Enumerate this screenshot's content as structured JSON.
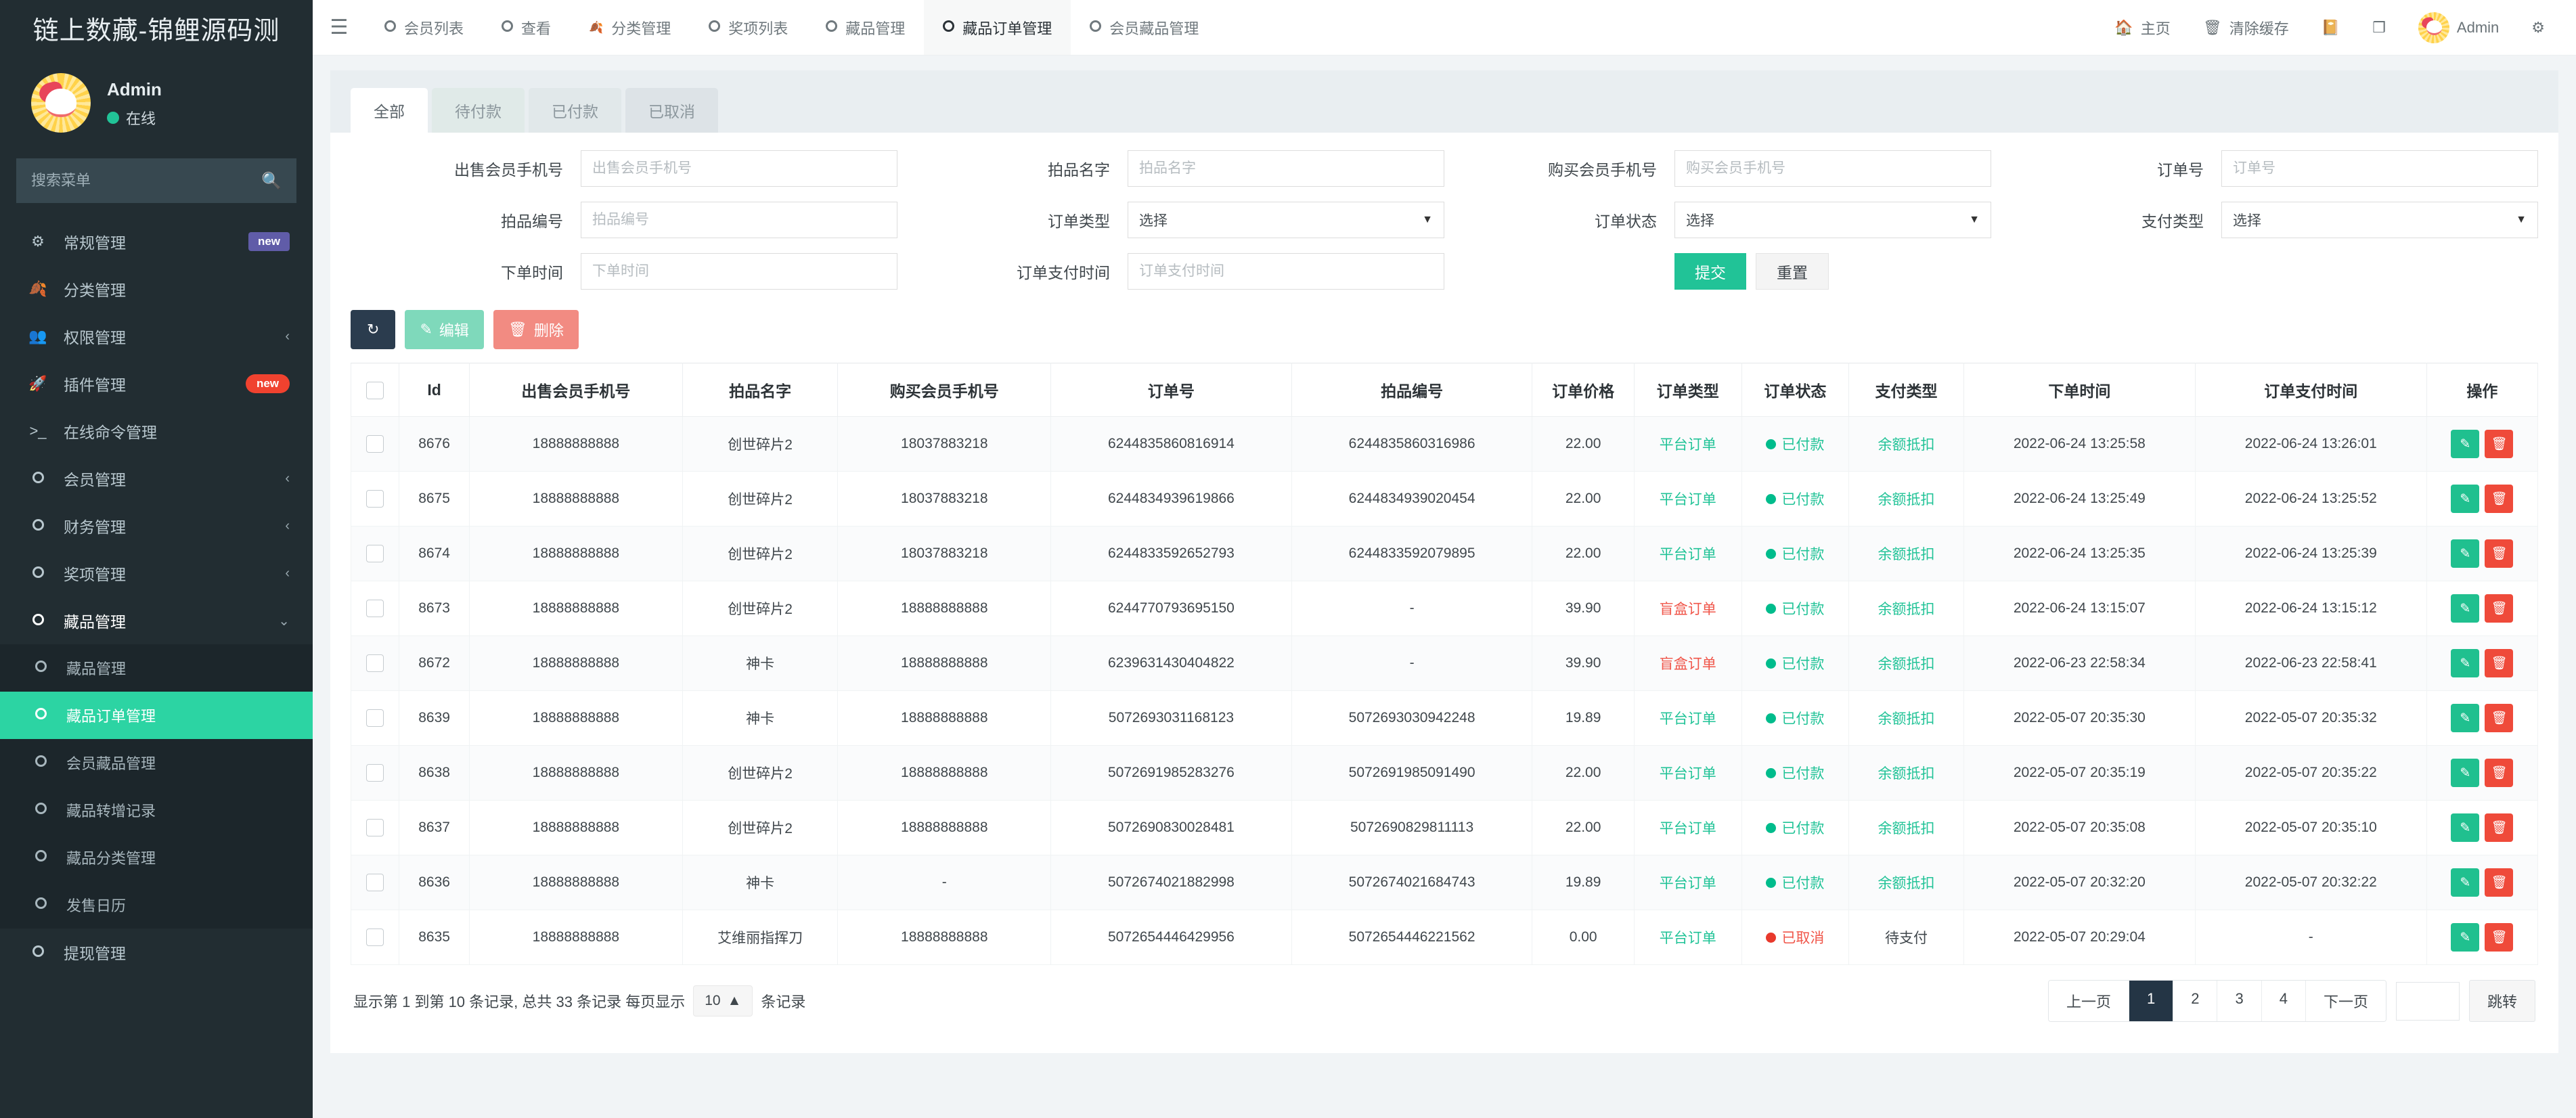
{
  "sidebar": {
    "brand": "链上数藏-锦鲤源码测",
    "user": {
      "name": "Admin",
      "status": "在线"
    },
    "search_placeholder": "搜索菜单",
    "items": [
      {
        "label": "常规管理",
        "icon": "gears-icon",
        "badge": "new",
        "badge_color": "purple",
        "chev": ""
      },
      {
        "label": "分类管理",
        "icon": "leaf-icon",
        "badge": "",
        "badge_color": "",
        "chev": ""
      },
      {
        "label": "权限管理",
        "icon": "users-icon",
        "badge": "",
        "badge_color": "",
        "chev": "‹"
      },
      {
        "label": "插件管理",
        "icon": "rocket-icon",
        "badge": "new",
        "badge_color": "red",
        "chev": ""
      },
      {
        "label": "在线命令管理",
        "icon": "terminal-icon",
        "badge": "",
        "badge_color": "",
        "chev": ""
      },
      {
        "label": "会员管理",
        "icon": "circle-icon",
        "badge": "",
        "badge_color": "",
        "chev": "‹"
      },
      {
        "label": "财务管理",
        "icon": "circle-icon",
        "badge": "",
        "badge_color": "",
        "chev": "‹"
      },
      {
        "label": "奖项管理",
        "icon": "circle-icon",
        "badge": "",
        "badge_color": "",
        "chev": "‹"
      },
      {
        "label": "藏品管理",
        "icon": "circle-icon",
        "badge": "",
        "badge_color": "",
        "chev": "⌄",
        "active": true
      }
    ],
    "subitems": [
      {
        "label": "藏品管理",
        "active": false
      },
      {
        "label": "藏品订单管理",
        "active": true
      },
      {
        "label": "会员藏品管理",
        "active": false
      },
      {
        "label": "藏品转增记录",
        "active": false
      },
      {
        "label": "藏品分类管理",
        "active": false
      },
      {
        "label": "发售日历",
        "active": false
      },
      {
        "label": "提现管理",
        "active": false
      }
    ]
  },
  "topbar": {
    "menu_icon": "hamburger-icon",
    "tabs": [
      {
        "label": "会员列表",
        "icon": "circle-icon",
        "active": false
      },
      {
        "label": "查看",
        "icon": "circle-icon",
        "active": false
      },
      {
        "label": "分类管理",
        "icon": "leaf-icon",
        "active": false
      },
      {
        "label": "奖项列表",
        "icon": "circle-icon",
        "active": false
      },
      {
        "label": "藏品管理",
        "icon": "circle-icon",
        "active": false
      },
      {
        "label": "藏品订单管理",
        "icon": "circle-icon",
        "active": true
      },
      {
        "label": "会员藏品管理",
        "icon": "circle-icon",
        "active": false
      }
    ],
    "right": [
      {
        "label": "主页",
        "icon": "home-icon"
      },
      {
        "label": "清除缓存",
        "icon": "trash-icon"
      },
      {
        "label": "",
        "icon": "book-icon"
      },
      {
        "label": "",
        "icon": "fullscreen-icon"
      },
      {
        "label": "Admin",
        "icon": "avatar-icon"
      },
      {
        "label": "",
        "icon": "gear-icon"
      }
    ]
  },
  "tabs": [
    {
      "label": "全部",
      "active": true
    },
    {
      "label": "待付款",
      "active": false
    },
    {
      "label": "已付款",
      "active": false
    },
    {
      "label": "已取消",
      "active": false
    }
  ],
  "filters": {
    "row1": [
      {
        "label": "出售会员手机号",
        "placeholder": "出售会员手机号",
        "value": "",
        "type": "text"
      },
      {
        "label": "拍品名字",
        "placeholder": "拍品名字",
        "value": "",
        "type": "text"
      },
      {
        "label": "购买会员手机号",
        "placeholder": "购买会员手机号",
        "value": "",
        "type": "text"
      },
      {
        "label": "订单号",
        "placeholder": "订单号",
        "value": "",
        "type": "text"
      }
    ],
    "row2": [
      {
        "label": "拍品编号",
        "placeholder": "拍品编号",
        "value": "",
        "type": "text"
      },
      {
        "label": "订单类型",
        "placeholder": "",
        "value": "选择",
        "type": "select"
      },
      {
        "label": "订单状态",
        "placeholder": "",
        "value": "选择",
        "type": "select"
      },
      {
        "label": "支付类型",
        "placeholder": "",
        "value": "选择",
        "type": "select"
      }
    ],
    "row3": [
      {
        "label": "下单时间",
        "placeholder": "下单时间",
        "value": "",
        "type": "text"
      },
      {
        "label": "订单支付时间",
        "placeholder": "订单支付时间",
        "value": "",
        "type": "text"
      }
    ],
    "submit_label": "提交",
    "reset_label": "重置"
  },
  "toolbar": {
    "refresh_icon": "refresh-icon",
    "edit_label": "编辑",
    "edit_icon": "pencil-icon",
    "delete_label": "删除",
    "delete_icon": "trash-icon"
  },
  "table": {
    "columns": [
      "",
      "Id",
      "出售会员手机号",
      "拍品名字",
      "购买会员手机号",
      "订单号",
      "拍品编号",
      "订单价格",
      "订单类型",
      "订单状态",
      "支付类型",
      "下单时间",
      "订单支付时间",
      "操作"
    ],
    "rows": [
      {
        "id": "8676",
        "seller": "18888888888",
        "item": "创世碎片2",
        "buyer": "18037883218",
        "order_no": "6244835860816914",
        "item_no": "6244835860316986",
        "price": "22.00",
        "order_type": "平台订单",
        "order_type_color": "green",
        "status": "已付款",
        "status_color": "green",
        "pay_type": "余额抵扣",
        "pay_type_color": "green",
        "order_time": "2022-06-24 13:25:58",
        "pay_time": "2022-06-24 13:26:01"
      },
      {
        "id": "8675",
        "seller": "18888888888",
        "item": "创世碎片2",
        "buyer": "18037883218",
        "order_no": "6244834939619866",
        "item_no": "6244834939020454",
        "price": "22.00",
        "order_type": "平台订单",
        "order_type_color": "green",
        "status": "已付款",
        "status_color": "green",
        "pay_type": "余额抵扣",
        "pay_type_color": "green",
        "order_time": "2022-06-24 13:25:49",
        "pay_time": "2022-06-24 13:25:52"
      },
      {
        "id": "8674",
        "seller": "18888888888",
        "item": "创世碎片2",
        "buyer": "18037883218",
        "order_no": "6244833592652793",
        "item_no": "6244833592079895",
        "price": "22.00",
        "order_type": "平台订单",
        "order_type_color": "green",
        "status": "已付款",
        "status_color": "green",
        "pay_type": "余额抵扣",
        "pay_type_color": "green",
        "order_time": "2022-06-24 13:25:35",
        "pay_time": "2022-06-24 13:25:39"
      },
      {
        "id": "8673",
        "seller": "18888888888",
        "item": "创世碎片2",
        "buyer": "18888888888",
        "order_no": "6244770793695150",
        "item_no": "-",
        "price": "39.90",
        "order_type": "盲盒订单",
        "order_type_color": "red",
        "status": "已付款",
        "status_color": "green",
        "pay_type": "余额抵扣",
        "pay_type_color": "green",
        "order_time": "2022-06-24 13:15:07",
        "pay_time": "2022-06-24 13:15:12"
      },
      {
        "id": "8672",
        "seller": "18888888888",
        "item": "神卡",
        "buyer": "18888888888",
        "order_no": "6239631430404822",
        "item_no": "-",
        "price": "39.90",
        "order_type": "盲盒订单",
        "order_type_color": "red",
        "status": "已付款",
        "status_color": "green",
        "pay_type": "余额抵扣",
        "pay_type_color": "green",
        "order_time": "2022-06-23 22:58:34",
        "pay_time": "2022-06-23 22:58:41"
      },
      {
        "id": "8639",
        "seller": "18888888888",
        "item": "神卡",
        "buyer": "18888888888",
        "order_no": "5072693031168123",
        "item_no": "5072693030942248",
        "price": "19.89",
        "order_type": "平台订单",
        "order_type_color": "green",
        "status": "已付款",
        "status_color": "green",
        "pay_type": "余额抵扣",
        "pay_type_color": "green",
        "order_time": "2022-05-07 20:35:30",
        "pay_time": "2022-05-07 20:35:32"
      },
      {
        "id": "8638",
        "seller": "18888888888",
        "item": "创世碎片2",
        "buyer": "18888888888",
        "order_no": "5072691985283276",
        "item_no": "5072691985091490",
        "price": "22.00",
        "order_type": "平台订单",
        "order_type_color": "green",
        "status": "已付款",
        "status_color": "green",
        "pay_type": "余额抵扣",
        "pay_type_color": "green",
        "order_time": "2022-05-07 20:35:19",
        "pay_time": "2022-05-07 20:35:22"
      },
      {
        "id": "8637",
        "seller": "18888888888",
        "item": "创世碎片2",
        "buyer": "18888888888",
        "order_no": "5072690830028481",
        "item_no": "5072690829811113",
        "price": "22.00",
        "order_type": "平台订单",
        "order_type_color": "green",
        "status": "已付款",
        "status_color": "green",
        "pay_type": "余额抵扣",
        "pay_type_color": "green",
        "order_time": "2022-05-07 20:35:08",
        "pay_time": "2022-05-07 20:35:10"
      },
      {
        "id": "8636",
        "seller": "18888888888",
        "item": "神卡",
        "buyer": "-",
        "order_no": "5072674021882998",
        "item_no": "5072674021684743",
        "price": "19.89",
        "order_type": "平台订单",
        "order_type_color": "green",
        "status": "已付款",
        "status_color": "green",
        "pay_type": "余额抵扣",
        "pay_type_color": "green",
        "order_time": "2022-05-07 20:32:20",
        "pay_time": "2022-05-07 20:32:22"
      },
      {
        "id": "8635",
        "seller": "18888888888",
        "item": "艾维丽指挥刀",
        "buyer": "18888888888",
        "order_no": "5072654446429956",
        "item_no": "5072654446221562",
        "price": "0.00",
        "order_type": "平台订单",
        "order_type_color": "green",
        "status": "已取消",
        "status_color": "red",
        "pay_type": "待支付",
        "pay_type_color": "plain",
        "order_time": "2022-05-07 20:29:04",
        "pay_time": "-"
      }
    ]
  },
  "footer": {
    "info_prefix": "显示第 1 到第 10 条记录, 总共 33 条记录 每页显示",
    "page_size": "10",
    "info_suffix": "条记录",
    "prev_label": "上一页",
    "pages": [
      "1",
      "2",
      "3",
      "4"
    ],
    "current_page": "1",
    "next_label": "下一页",
    "jump_value": "",
    "jump_label": "跳转"
  },
  "colors": {
    "accent": "#21c397",
    "sidebar_bg": "#222d32",
    "danger": "#f0564a",
    "dark": "#243545"
  }
}
